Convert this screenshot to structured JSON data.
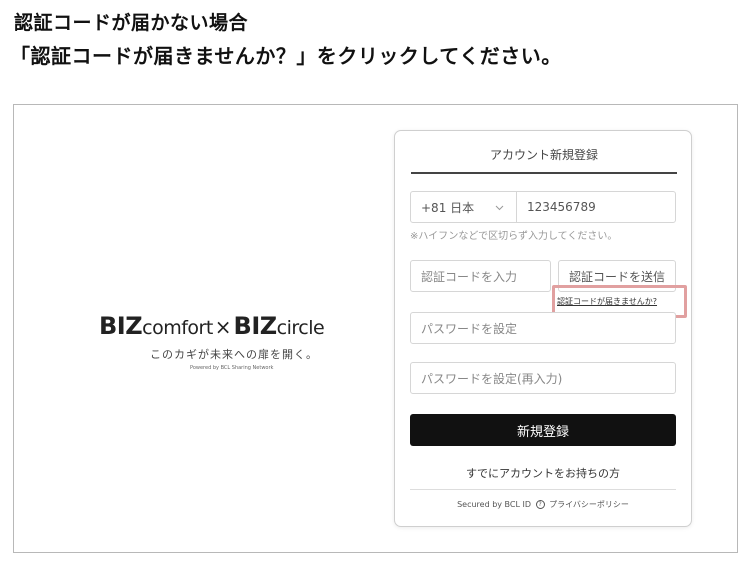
{
  "heading": {
    "line1": "認証コードが届かない場合",
    "line2": "「認証コードが届きませんか？」をクリックしてください。"
  },
  "brand": {
    "biz1": "BIZ",
    "comfort": "comfort",
    "times": "×",
    "biz2": "BIZ",
    "circle": "circle",
    "tagline": "このカギが未来への扉を開く。",
    "powered": "Powered by BCL Sharing Network"
  },
  "form": {
    "title": "アカウント新規登録",
    "country_code": "+81 日本",
    "phone_value": "123456789",
    "phone_hint": "※ハイフンなどで区切らず入力してください。",
    "code_placeholder": "認証コードを入力",
    "send_code_label": "認証コードを送信",
    "resend_link": "認証コードが届きませんか?",
    "password_placeholder": "パスワードを設定",
    "password_confirm_placeholder": "パスワードを設定(再入力)",
    "register_label": "新規登録",
    "have_account": "すでにアカウントをお持ちの方",
    "secured_by": "Secured by BCL ID",
    "privacy": "プライバシーポリシー"
  },
  "colors": {
    "highlight": "#e1a0a0",
    "primary_button": "#111111"
  }
}
